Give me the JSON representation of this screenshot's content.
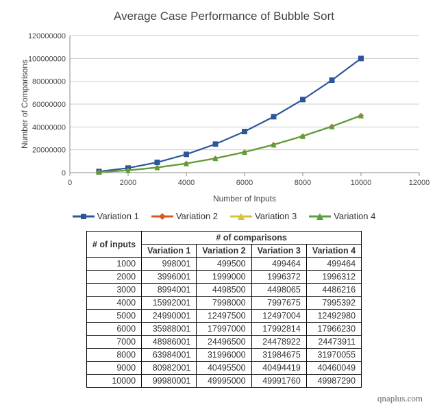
{
  "chart_data": {
    "type": "line",
    "title": "Average Case Performance of Bubble Sort",
    "xlabel": "Number of Inputs",
    "ylabel": "Number of Comparisons",
    "xlim": [
      0,
      12000
    ],
    "ylim": [
      0,
      120000000
    ],
    "x_ticks": [
      0,
      2000,
      4000,
      6000,
      8000,
      10000,
      12000
    ],
    "y_ticks": [
      0,
      20000000,
      40000000,
      60000000,
      80000000,
      100000000,
      120000000
    ],
    "x": [
      1000,
      2000,
      3000,
      4000,
      5000,
      6000,
      7000,
      8000,
      9000,
      10000
    ],
    "series": [
      {
        "name": "Variation 1",
        "color": "#2b5699",
        "marker": "square",
        "values": [
          998001,
          3996001,
          8994001,
          15992001,
          24990001,
          35988001,
          48986001,
          63984001,
          80982001,
          99980001
        ]
      },
      {
        "name": "Variation 2",
        "color": "#d9581f",
        "marker": "diamond",
        "values": [
          499500,
          1999000,
          4498500,
          7998000,
          12497500,
          17997000,
          24496500,
          31996000,
          40495500,
          49995000
        ]
      },
      {
        "name": "Variation 3",
        "color": "#d9c334",
        "marker": "triangle",
        "values": [
          499464,
          1996372,
          4498065,
          7997675,
          12497004,
          17992814,
          24478922,
          31984675,
          40494419,
          49991760
        ]
      },
      {
        "name": "Variation 4",
        "color": "#5a9e3d",
        "marker": "triangle",
        "values": [
          499464,
          1996312,
          4486216,
          7995392,
          12492980,
          17966230,
          24473911,
          31970055,
          40460049,
          49987290
        ]
      }
    ]
  },
  "legend": {
    "items": [
      "Variation 1",
      "Variation 2",
      "Variation 3",
      "Variation 4"
    ]
  },
  "table": {
    "super_header": "# of comparisons",
    "row_header": "# of inputs",
    "columns": [
      "Variation 1",
      "Variation 2",
      "Variation 3",
      "Variation 4"
    ],
    "rows": [
      {
        "input": 1000,
        "values": [
          998001,
          499500,
          499464,
          499464
        ]
      },
      {
        "input": 2000,
        "values": [
          3996001,
          1999000,
          1996372,
          1996312
        ]
      },
      {
        "input": 3000,
        "values": [
          8994001,
          4498500,
          4498065,
          4486216
        ]
      },
      {
        "input": 4000,
        "values": [
          15992001,
          7998000,
          7997675,
          7995392
        ]
      },
      {
        "input": 5000,
        "values": [
          24990001,
          12497500,
          12497004,
          12492980
        ]
      },
      {
        "input": 6000,
        "values": [
          35988001,
          17997000,
          17992814,
          17966230
        ]
      },
      {
        "input": 7000,
        "values": [
          48986001,
          24496500,
          24478922,
          24473911
        ]
      },
      {
        "input": 8000,
        "values": [
          63984001,
          31996000,
          31984675,
          31970055
        ]
      },
      {
        "input": 9000,
        "values": [
          80982001,
          40495500,
          40494419,
          40460049
        ]
      },
      {
        "input": 10000,
        "values": [
          99980001,
          49995000,
          49991760,
          49987290
        ]
      }
    ]
  },
  "attribution": "qnaplus.com"
}
